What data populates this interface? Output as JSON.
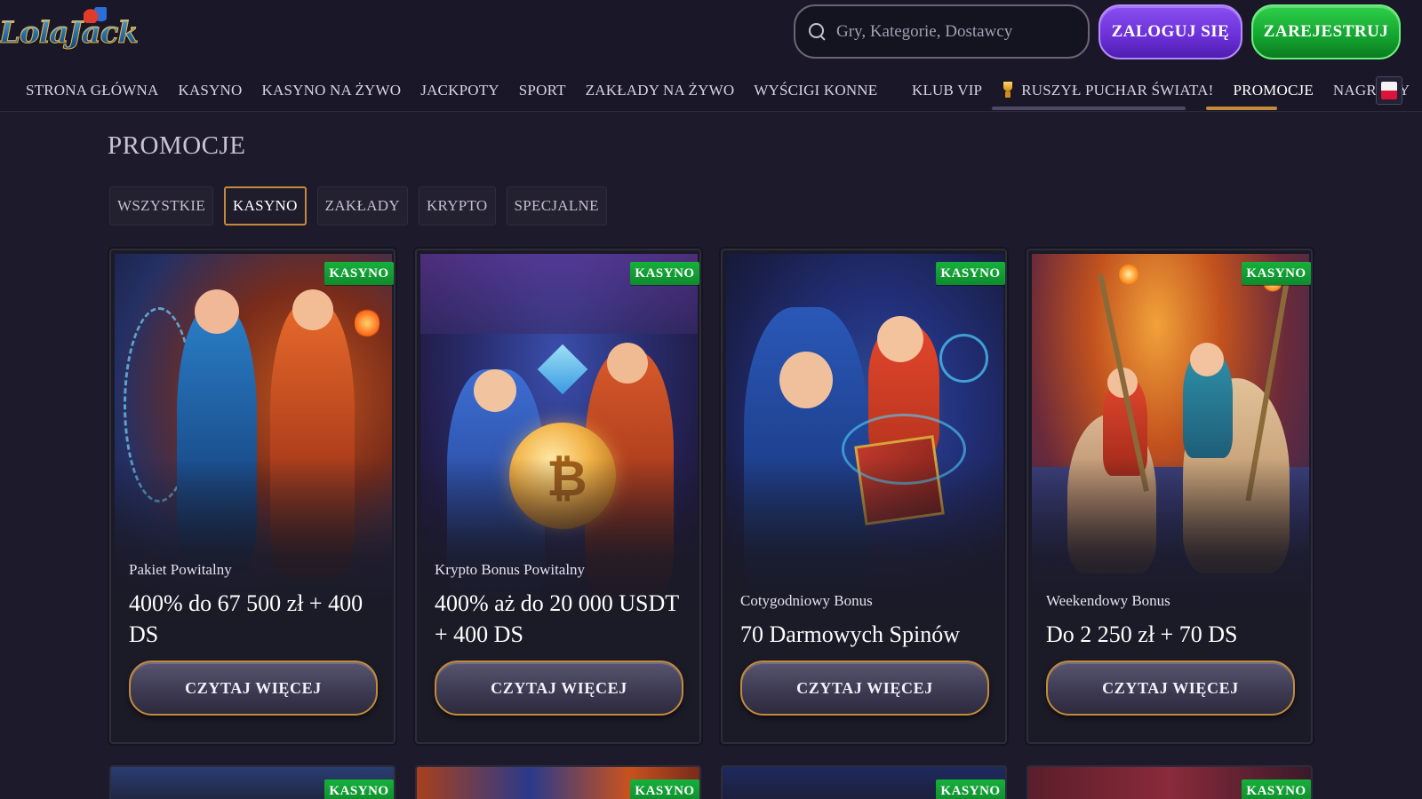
{
  "header": {
    "logo_text": "LolaJack",
    "search_placeholder": "Gry, Kategorie, Dostawcy",
    "login_label": "ZALOGUJ SIĘ",
    "register_label": "ZAREJESTRUJ"
  },
  "nav": {
    "main": [
      {
        "label": "STRONA GŁÓWNA"
      },
      {
        "label": "KASYNO"
      },
      {
        "label": "KASYNO NA ŻYWO"
      },
      {
        "label": "JACKPOTY"
      },
      {
        "label": "SPORT"
      },
      {
        "label": "ZAKŁADY NA ŻYWO"
      },
      {
        "label": "WYŚCIGI KONNE"
      }
    ],
    "right": [
      {
        "label": "KLUB VIP"
      },
      {
        "label": "RUSZYŁ PUCHAR ŚWIATA!"
      },
      {
        "label": "PROMOCJE"
      },
      {
        "label": "NAGRODY"
      }
    ]
  },
  "page": {
    "title": "PROMOCJE",
    "tabs": [
      {
        "label": "WSZYSTKIE",
        "active": false
      },
      {
        "label": "KASYNO",
        "active": true
      },
      {
        "label": "ZAKŁADY",
        "active": false
      },
      {
        "label": "KRYPTO",
        "active": false
      },
      {
        "label": "SPECJALNE",
        "active": false
      }
    ]
  },
  "cards": [
    {
      "badge": "KASYNO",
      "subtitle": "Pakiet Powitalny",
      "title": "400% do 67 500 zł + 400 DS",
      "button": "CZYTAJ WIĘCEJ"
    },
    {
      "badge": "KASYNO",
      "subtitle": "Krypto Bonus Powitalny",
      "title": "400% aż do 20 000 USDT + 400 DS",
      "button": "CZYTAJ WIĘCEJ"
    },
    {
      "badge": "KASYNO",
      "subtitle": "Cotygodniowy Bonus",
      "title": "70 Darmowych Spinów",
      "button": "CZYTAJ WIĘCEJ"
    },
    {
      "badge": "KASYNO",
      "subtitle": "Weekendowy Bonus",
      "title": "Do 2 250 zł + 70 DS",
      "button": "CZYTAJ WIĘCEJ"
    }
  ],
  "bottom_cards": [
    {
      "badge": "KASYNO"
    },
    {
      "badge": "KASYNO"
    },
    {
      "badge": "KASYNO"
    },
    {
      "badge": "KASYNO"
    }
  ],
  "colors": {
    "background": "#1d1b2b",
    "accent_gold": "#c48a3a",
    "login_purple": "#6a2fd6",
    "register_green": "#13a32f",
    "badge_green": "#16b03b"
  },
  "icons": {
    "search": "search-icon",
    "cup": "trophy-icon",
    "flag": "poland-flag-icon"
  }
}
